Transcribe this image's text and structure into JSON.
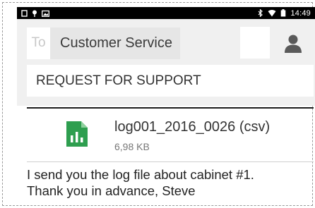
{
  "status_bar": {
    "time": "14:49",
    "left_icons": [
      "screen-icon",
      "notification-pin-icon",
      "image-icon"
    ],
    "right_icons": [
      "bluetooth-icon",
      "wifi-icon",
      "battery-icon"
    ]
  },
  "compose": {
    "to_label": "To",
    "recipient": "Customer Service",
    "subject": "REQUEST FOR SUPPORT"
  },
  "attachment": {
    "name": "log001_2016_0026 (csv)",
    "size": "6,98 KB",
    "icon": "spreadsheet-file-icon"
  },
  "message": {
    "line1": "I send you the log file about cabinet #1.",
    "line2": "Thank you in advance, Steve"
  },
  "colors": {
    "status_bar": "#000000",
    "file_icon_green": "#2e9e4f",
    "panel": "#f0f0f0"
  }
}
